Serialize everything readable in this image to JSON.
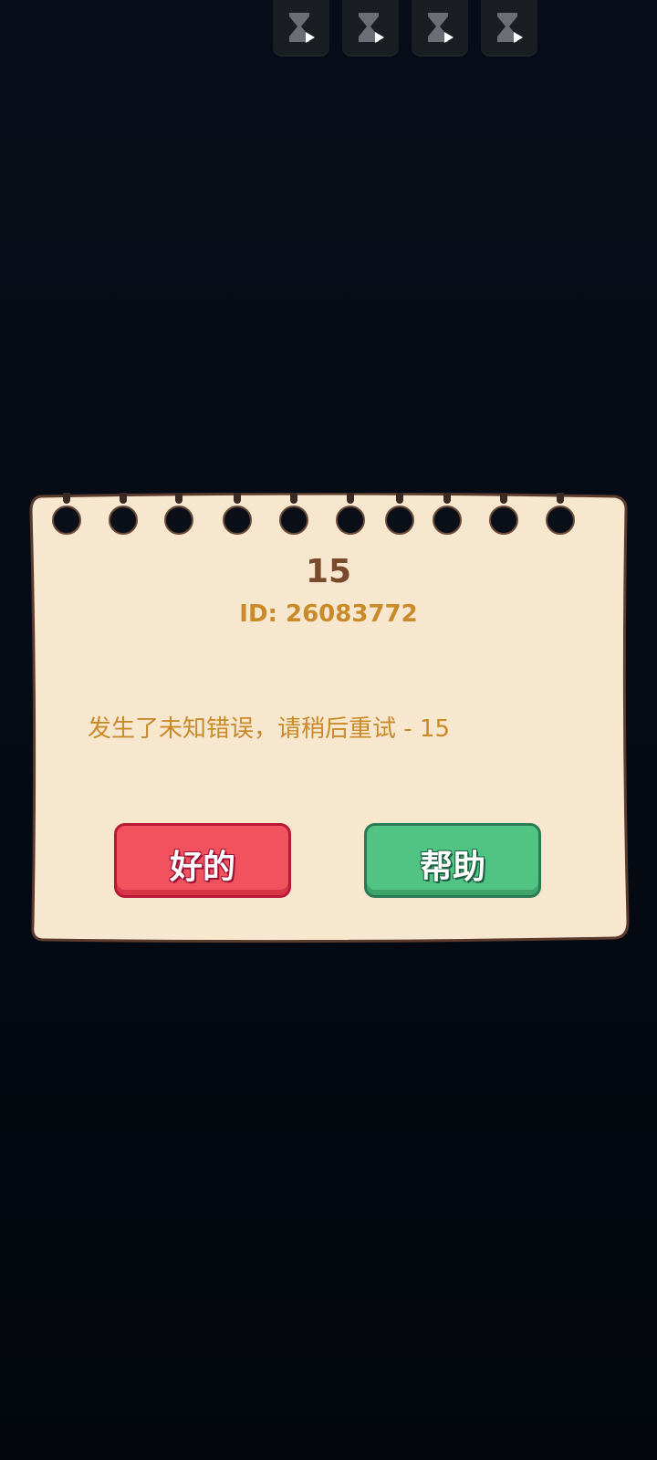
{
  "top_bar": {
    "slots": [
      {
        "icon": "hourglass-play-icon"
      },
      {
        "icon": "hourglass-play-icon"
      },
      {
        "icon": "hourglass-play-icon"
      },
      {
        "icon": "hourglass-play-icon"
      }
    ]
  },
  "dialog": {
    "code": "15",
    "id_text": "ID: 26083772",
    "message": "发生了未知错误，请稍后重试 - 15",
    "ok_label": "好的",
    "help_label": "帮助"
  },
  "colors": {
    "paper": "#f8e7cf",
    "paper_border": "#5a3a2c",
    "title_brown": "#7a4a2c",
    "text_orange": "#c98a2a",
    "ok_red": "#f1525e",
    "help_green": "#51c483"
  }
}
